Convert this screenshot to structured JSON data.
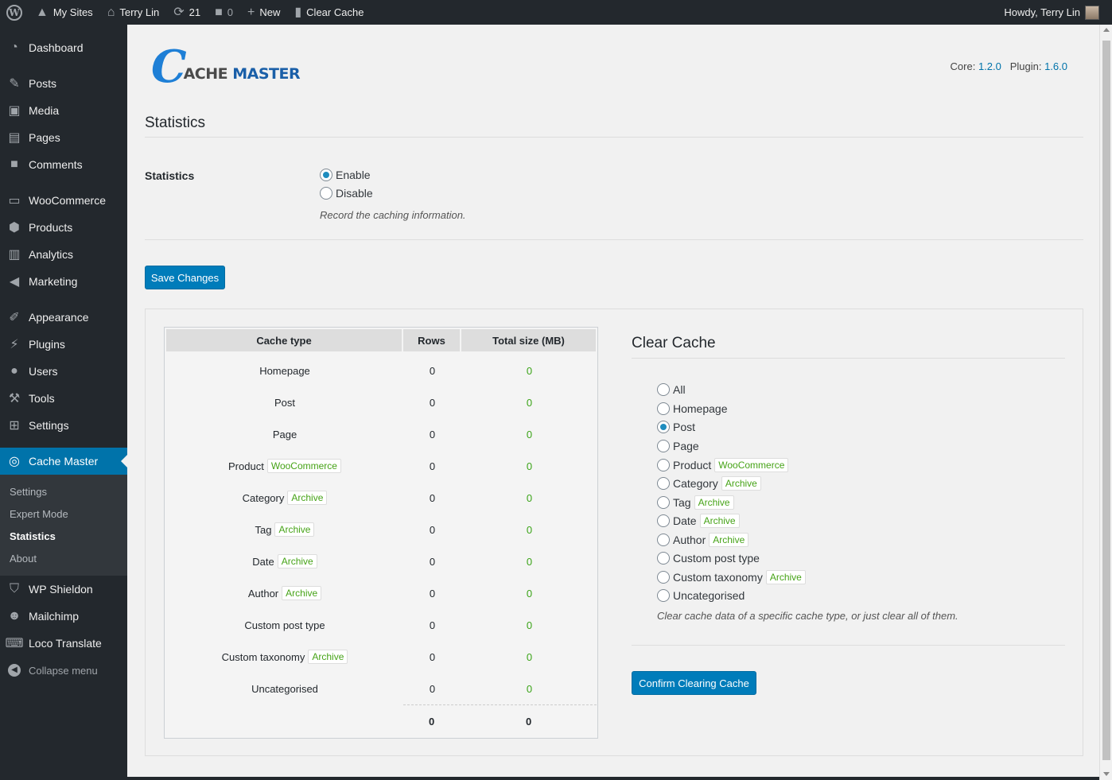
{
  "adminbar": {
    "my_sites": "My Sites",
    "site_name": "Terry Lin",
    "updates_count": "21",
    "comments_count": "0",
    "new_label": "New",
    "clear_cache_label": "Clear Cache",
    "howdy": "Howdy, Terry Lin"
  },
  "sidebar": {
    "items": [
      {
        "label": "Dashboard",
        "icon": "dashboard-icon"
      },
      {
        "label": "Posts",
        "icon": "pin-icon"
      },
      {
        "label": "Media",
        "icon": "media-icon"
      },
      {
        "label": "Pages",
        "icon": "pages-icon"
      },
      {
        "label": "Comments",
        "icon": "comment-icon"
      },
      {
        "label": "WooCommerce",
        "icon": "woo-icon"
      },
      {
        "label": "Products",
        "icon": "box-icon"
      },
      {
        "label": "Analytics",
        "icon": "chart-icon"
      },
      {
        "label": "Marketing",
        "icon": "megaphone-icon"
      },
      {
        "label": "Appearance",
        "icon": "brush-icon"
      },
      {
        "label": "Plugins",
        "icon": "plug-icon"
      },
      {
        "label": "Users",
        "icon": "user-icon"
      },
      {
        "label": "Tools",
        "icon": "wrench-icon"
      },
      {
        "label": "Settings",
        "icon": "settings-icon"
      },
      {
        "label": "Cache Master",
        "icon": "cache-master-icon"
      },
      {
        "label": "WP Shieldon",
        "icon": "shield-icon"
      },
      {
        "label": "Mailchimp",
        "icon": "mailchimp-icon"
      },
      {
        "label": "Loco Translate",
        "icon": "translate-icon"
      }
    ],
    "submenu": [
      "Settings",
      "Expert Mode",
      "Statistics",
      "About"
    ],
    "collapse": "Collapse menu"
  },
  "header": {
    "logo_c": "C",
    "logo_ache": "ACHE",
    "logo_master": "MASTER",
    "core_label": "Core:",
    "core_version": "1.2.0",
    "plugin_label": "Plugin:",
    "plugin_version": "1.6.0"
  },
  "statistics": {
    "title": "Statistics",
    "field_label": "Statistics",
    "enable": "Enable",
    "disable": "Disable",
    "description": "Record the caching information.",
    "save_button": "Save Changes"
  },
  "table": {
    "headers": [
      "Cache type",
      "Rows",
      "Total size (MB)"
    ],
    "rows": [
      {
        "type": "Homepage",
        "badge": "",
        "rows": "0",
        "size": "0"
      },
      {
        "type": "Post",
        "badge": "",
        "rows": "0",
        "size": "0"
      },
      {
        "type": "Page",
        "badge": "",
        "rows": "0",
        "size": "0"
      },
      {
        "type": "Product",
        "badge": "WooCommerce",
        "rows": "0",
        "size": "0"
      },
      {
        "type": "Category",
        "badge": "Archive",
        "rows": "0",
        "size": "0"
      },
      {
        "type": "Tag",
        "badge": "Archive",
        "rows": "0",
        "size": "0"
      },
      {
        "type": "Date",
        "badge": "Archive",
        "rows": "0",
        "size": "0"
      },
      {
        "type": "Author",
        "badge": "Archive",
        "rows": "0",
        "size": "0"
      },
      {
        "type": "Custom post type",
        "badge": "",
        "rows": "0",
        "size": "0"
      },
      {
        "type": "Custom taxonomy",
        "badge": "Archive",
        "rows": "0",
        "size": "0"
      },
      {
        "type": "Uncategorised",
        "badge": "",
        "rows": "0",
        "size": "0"
      }
    ],
    "total_rows": "0",
    "total_size": "0"
  },
  "clear_cache": {
    "title": "Clear Cache",
    "options": [
      {
        "label": "All",
        "badge": "",
        "checked": false
      },
      {
        "label": "Homepage",
        "badge": "",
        "checked": false
      },
      {
        "label": "Post",
        "badge": "",
        "checked": true
      },
      {
        "label": "Page",
        "badge": "",
        "checked": false
      },
      {
        "label": "Product",
        "badge": "WooCommerce",
        "checked": false
      },
      {
        "label": "Category",
        "badge": "Archive",
        "checked": false
      },
      {
        "label": "Tag",
        "badge": "Archive",
        "checked": false
      },
      {
        "label": "Date",
        "badge": "Archive",
        "checked": false
      },
      {
        "label": "Author",
        "badge": "Archive",
        "checked": false
      },
      {
        "label": "Custom post type",
        "badge": "",
        "checked": false
      },
      {
        "label": "Custom taxonomy",
        "badge": "Archive",
        "checked": false
      },
      {
        "label": "Uncategorised",
        "badge": "",
        "checked": false
      }
    ],
    "description": "Clear cache data of a specific cache type, or just clear all of them.",
    "confirm_button": "Confirm Clearing Cache"
  },
  "colors": {
    "accent": "#0073aa",
    "sidebar_bg": "#23282d",
    "badge_green": "#46a317"
  }
}
